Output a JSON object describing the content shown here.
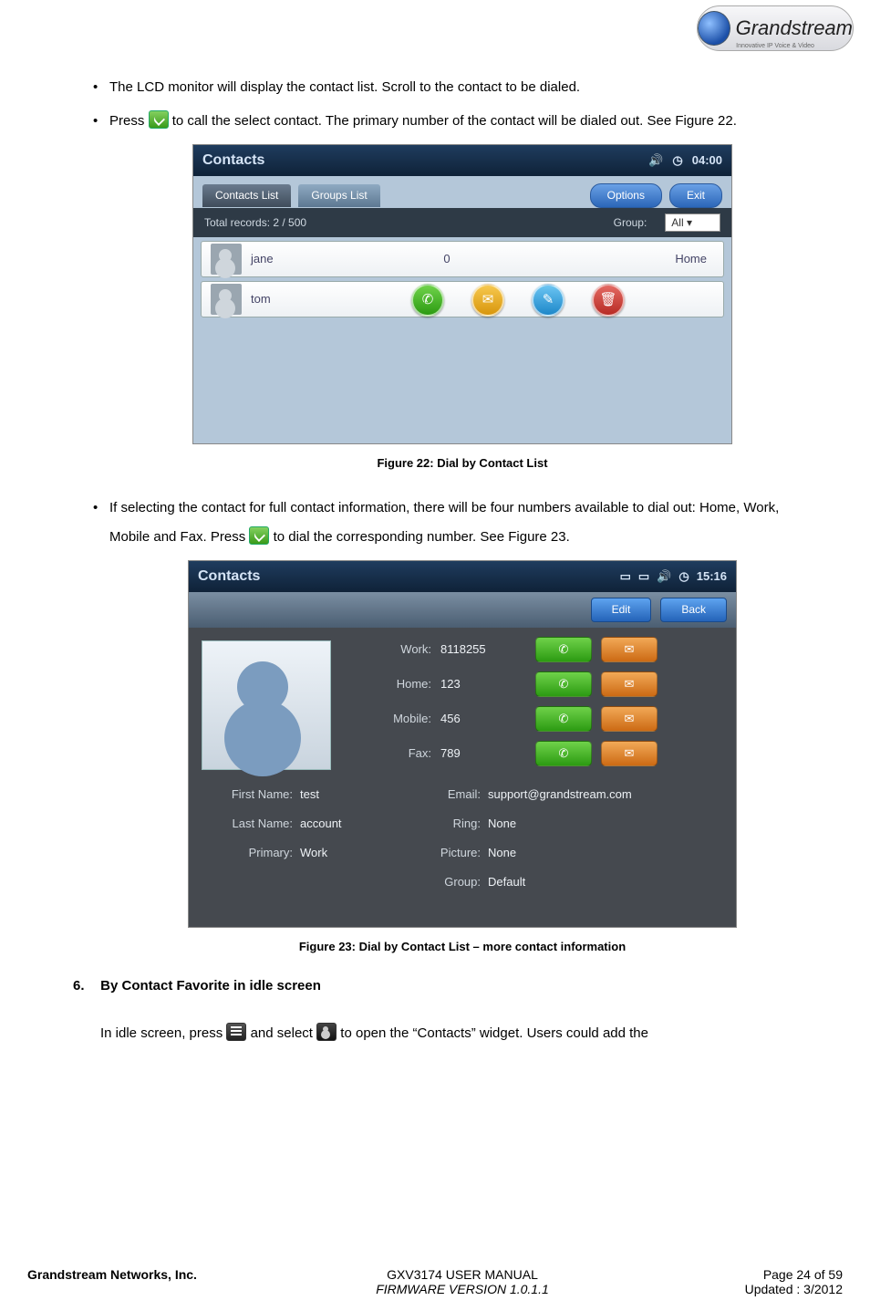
{
  "logo": {
    "brand": "Grandstream",
    "tagline": "Innovative IP Voice & Video"
  },
  "bullets": {
    "b1": "The LCD monitor will display the contact list. Scroll to the contact to be dialed.",
    "b2a": "Press ",
    "b2b": " to call the select contact. The primary number of the contact will be dialed out. See Figure 22.",
    "b3a": "If selecting the contact for full contact information, there will be four numbers available to dial out: Home, Work, Mobile and Fax. Press ",
    "b3b": " to dial the corresponding number. See Figure 23."
  },
  "fig22": {
    "caption": "Figure 22: Dial by Contact List",
    "title": "Contacts",
    "time": "04:00",
    "tabs": {
      "contacts": "Contacts List",
      "groups": "Groups List"
    },
    "buttons": {
      "options": "Options",
      "exit": "Exit"
    },
    "summary": {
      "total": "Total records: 2 / 500",
      "group_label": "Group:",
      "group_value": "All"
    },
    "rows": [
      {
        "name": "jane",
        "number": "0",
        "type": "Home"
      },
      {
        "name": "tom",
        "number": "",
        "type": ""
      }
    ]
  },
  "fig23": {
    "caption": "Figure 23: Dial by Contact List – more contact information",
    "title": "Contacts",
    "time": "15:16",
    "buttons": {
      "edit": "Edit",
      "back": "Back"
    },
    "numbers": {
      "work_label": "Work:",
      "work": "8118255",
      "home_label": "Home:",
      "home": "123",
      "mobile_label": "Mobile:",
      "mobile": "456",
      "fax_label": "Fax:",
      "fax": "789"
    },
    "info": {
      "first_name_label": "First Name:",
      "first_name": "test",
      "last_name_label": "Last Name:",
      "last_name": "account",
      "primary_label": "Primary:",
      "primary": "Work",
      "email_label": "Email:",
      "email": "support@grandstream.com",
      "ring_label": "Ring:",
      "ring": "None",
      "picture_label": "Picture:",
      "picture": "None",
      "group_label": "Group:",
      "group": "Default"
    }
  },
  "section6": {
    "num": "6.",
    "title": "By Contact Favorite in idle screen",
    "body_a": "In idle screen, press ",
    "body_b": " and select ",
    "body_c": "to open the “Contacts” widget. Users could add the"
  },
  "footer": {
    "company": "Grandstream Networks, Inc.",
    "manual": "GXV3174 USER MANUAL",
    "page": "Page 24 of 59",
    "fw": "FIRMWARE VERSION 1.0.1.1",
    "updated": "Updated : 3/2012"
  }
}
